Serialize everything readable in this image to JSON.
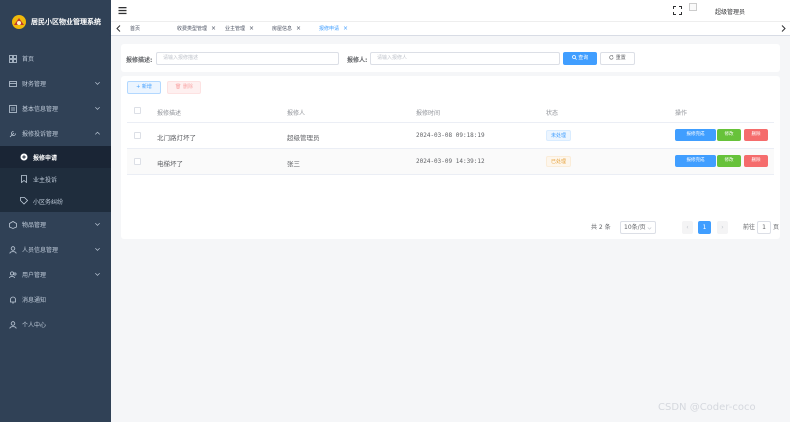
{
  "brand": {
    "title": "居民小区物业管理系统"
  },
  "sidebar": {
    "items": [
      {
        "label": "首页",
        "icon": "dashboard-icon"
      },
      {
        "label": "财务管理",
        "icon": "finance-icon",
        "expandable": true
      },
      {
        "label": "基本信息管理",
        "icon": "info-icon",
        "expandable": true
      },
      {
        "label": "报修投诉管理",
        "icon": "repair-icon",
        "expandable": true,
        "expanded": true
      },
      {
        "label": "物品管理",
        "icon": "goods-icon",
        "expandable": true
      },
      {
        "label": "人员信息管理",
        "icon": "people-icon",
        "expandable": true
      },
      {
        "label": "用户管理",
        "icon": "user-icon",
        "expandable": true
      },
      {
        "label": "消息通知",
        "icon": "bell-icon"
      },
      {
        "label": "个人中心",
        "icon": "person-icon"
      }
    ],
    "subitems": [
      {
        "label": "报修申请",
        "active": true
      },
      {
        "label": "业主投诉",
        "active": false
      },
      {
        "label": "小区务纠纷",
        "active": false
      }
    ]
  },
  "navbar": {
    "username": "超级管理员"
  },
  "tags": [
    {
      "label": "首页"
    },
    {
      "label": "收费类型管理"
    },
    {
      "label": "业主管理"
    },
    {
      "label": "房屋信息"
    },
    {
      "label": "报修申请",
      "active": true
    }
  ],
  "search": {
    "desc_label": "报修描述:",
    "desc_placeholder": "请输入报修描述",
    "person_label": "报修人:",
    "person_placeholder": "请输入报修人",
    "query_button": "查询",
    "reset_button": "重置"
  },
  "toolbar": {
    "add_button": "新增",
    "delete_button": "删除"
  },
  "table": {
    "headers": [
      "报修描述",
      "报修人",
      "报修时间",
      "状态",
      "操作"
    ],
    "rows": [
      {
        "desc": "北门路灯坏了",
        "person": "超级管理员",
        "time": "2024-03-08 09:18:19",
        "status": "未处理",
        "status_color": "blue"
      },
      {
        "desc": "电梯坏了",
        "person": "张三",
        "time": "2024-03-09 14:39:12",
        "status": "已处理",
        "status_color": "orange"
      }
    ],
    "actions": {
      "handle": "报修完成",
      "edit": "修改",
      "delete": "删除"
    }
  },
  "pagination": {
    "total": "共 2 条",
    "page_size": "10条/页",
    "current_page": "1",
    "goto_label": "前往",
    "goto_value": "1",
    "page_suffix": "页"
  },
  "watermark": "CSDN @Coder-coco",
  "colors": {
    "sidebar": "#304156",
    "primary": "#409eff",
    "success": "#67c23a",
    "danger": "#f56c6c"
  }
}
